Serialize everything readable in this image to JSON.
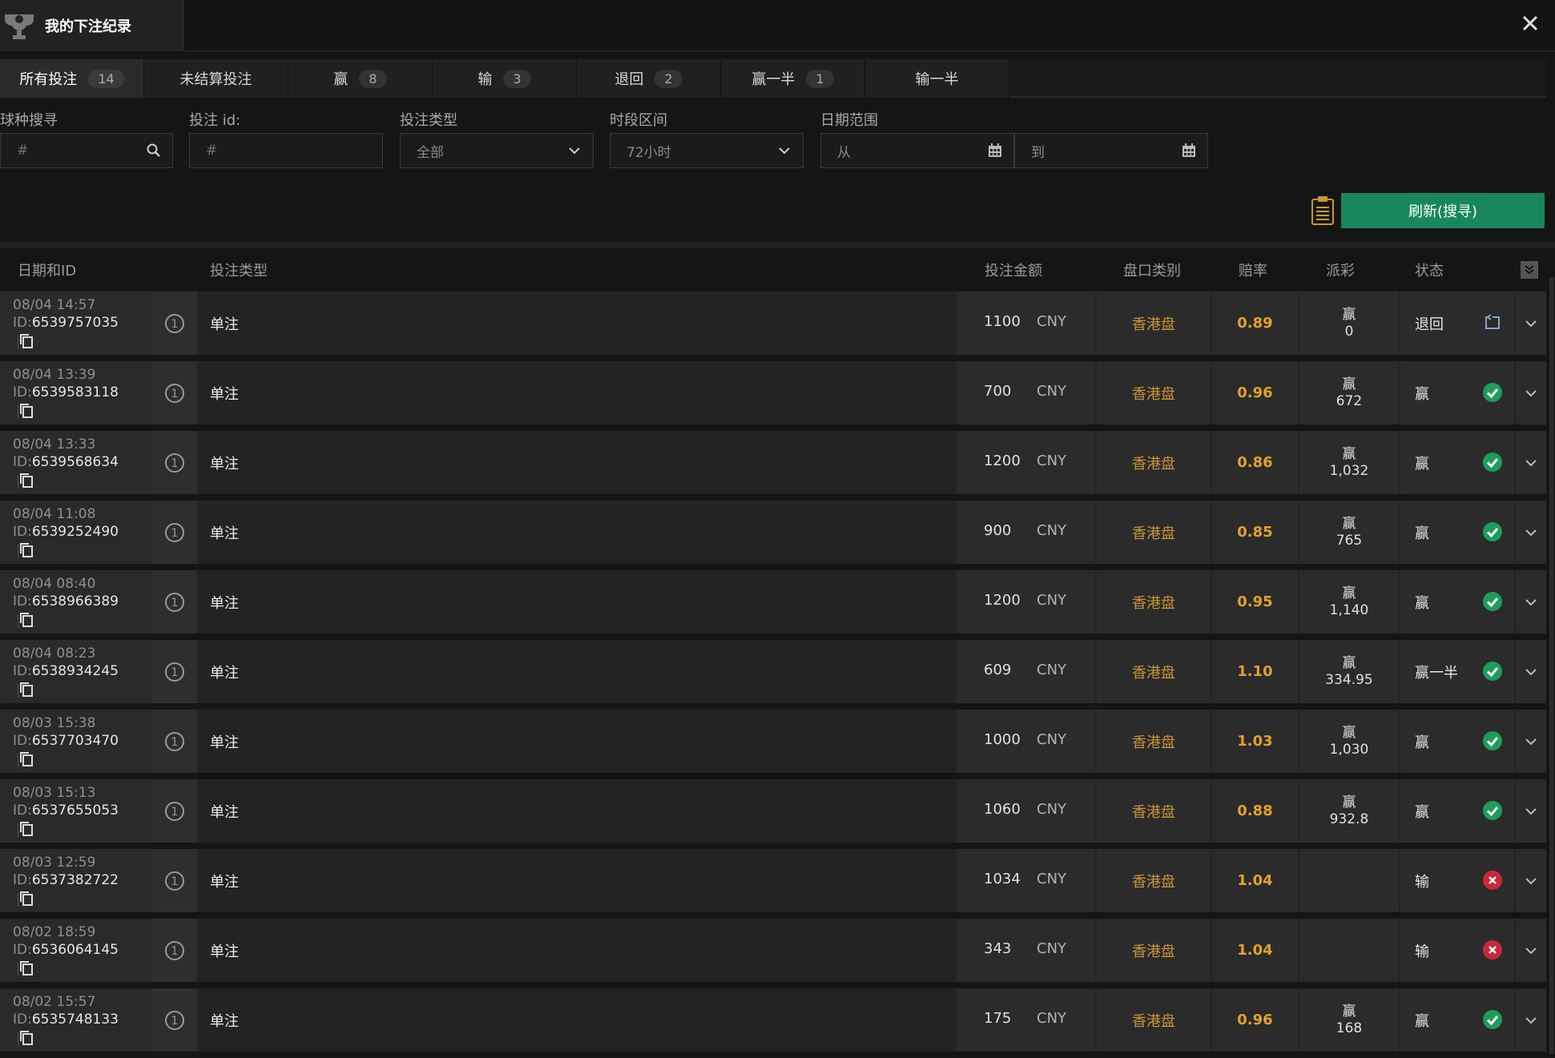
{
  "header": {
    "title": "我的下注纪录"
  },
  "tabs": [
    {
      "label": "所有投注",
      "count": "14"
    },
    {
      "label": "未结算投注",
      "count": ""
    },
    {
      "label": "赢",
      "count": "8"
    },
    {
      "label": "输",
      "count": "3"
    },
    {
      "label": "退回",
      "count": "2"
    },
    {
      "label": "赢一半",
      "count": "1"
    },
    {
      "label": "输一半",
      "count": ""
    }
  ],
  "filters": {
    "sport_label": "球种搜寻",
    "sport_placeholder": "#",
    "betid_label": "投注 id:",
    "betid_placeholder": "#",
    "bettype_label": "投注类型",
    "bettype_value": "全部",
    "period_label": "时段区间",
    "period_value": "72小时",
    "daterange_label": "日期范围",
    "from_placeholder": "从",
    "to_placeholder": "到"
  },
  "refresh_label": "刷新(搜寻)",
  "table_headers": {
    "date_id": "日期和ID",
    "bet_type": "投注类型",
    "amount": "投注金额",
    "market": "盘口类别",
    "odds": "赔率",
    "payout": "派彩",
    "status": "状态"
  },
  "colors": {
    "accent_green": "#18875b",
    "odds_orange": "#e3a12c",
    "market_gold": "#c99436",
    "win_green": "#1e9c5a",
    "lose_red": "#c8283c"
  },
  "rows": [
    {
      "date": "08/04 14:57",
      "id_prefix": "ID:",
      "id": "6539757035",
      "num": "1",
      "type": "单注",
      "amount": "1100",
      "currency": "CNY",
      "market": "香港盘",
      "odds": "0.89",
      "payout_label": "赢",
      "payout_value": "0",
      "status": "退回",
      "status_icon": "refund-icon"
    },
    {
      "date": "08/04 13:39",
      "id_prefix": "ID:",
      "id": "6539583118",
      "num": "1",
      "type": "单注",
      "amount": "700",
      "currency": "CNY",
      "market": "香港盘",
      "odds": "0.96",
      "payout_label": "赢",
      "payout_value": "672",
      "status": "赢",
      "status_icon": "check-icon"
    },
    {
      "date": "08/04 13:33",
      "id_prefix": "ID:",
      "id": "6539568634",
      "num": "1",
      "type": "单注",
      "amount": "1200",
      "currency": "CNY",
      "market": "香港盘",
      "odds": "0.86",
      "payout_label": "赢",
      "payout_value": "1,032",
      "status": "赢",
      "status_icon": "check-icon"
    },
    {
      "date": "08/04 11:08",
      "id_prefix": "ID:",
      "id": "6539252490",
      "num": "1",
      "type": "单注",
      "amount": "900",
      "currency": "CNY",
      "market": "香港盘",
      "odds": "0.85",
      "payout_label": "赢",
      "payout_value": "765",
      "status": "赢",
      "status_icon": "check-icon"
    },
    {
      "date": "08/04 08:40",
      "id_prefix": "ID:",
      "id": "6538966389",
      "num": "1",
      "type": "单注",
      "amount": "1200",
      "currency": "CNY",
      "market": "香港盘",
      "odds": "0.95",
      "payout_label": "赢",
      "payout_value": "1,140",
      "status": "赢",
      "status_icon": "check-icon"
    },
    {
      "date": "08/04 08:23",
      "id_prefix": "ID:",
      "id": "6538934245",
      "num": "1",
      "type": "单注",
      "amount": "609",
      "currency": "CNY",
      "market": "香港盘",
      "odds": "1.10",
      "payout_label": "赢",
      "payout_value": "334.95",
      "status": "赢一半",
      "status_icon": "check-icon"
    },
    {
      "date": "08/03 15:38",
      "id_prefix": "ID:",
      "id": "6537703470",
      "num": "1",
      "type": "单注",
      "amount": "1000",
      "currency": "CNY",
      "market": "香港盘",
      "odds": "1.03",
      "payout_label": "赢",
      "payout_value": "1,030",
      "status": "赢",
      "status_icon": "check-icon"
    },
    {
      "date": "08/03 15:13",
      "id_prefix": "ID:",
      "id": "6537655053",
      "num": "1",
      "type": "单注",
      "amount": "1060",
      "currency": "CNY",
      "market": "香港盘",
      "odds": "0.88",
      "payout_label": "赢",
      "payout_value": "932.8",
      "status": "赢",
      "status_icon": "check-icon"
    },
    {
      "date": "08/03 12:59",
      "id_prefix": "ID:",
      "id": "6537382722",
      "num": "1",
      "type": "单注",
      "amount": "1034",
      "currency": "CNY",
      "market": "香港盘",
      "odds": "1.04",
      "payout_label": "",
      "payout_value": "",
      "status": "输",
      "status_icon": "cross-icon"
    },
    {
      "date": "08/02 18:59",
      "id_prefix": "ID:",
      "id": "6536064145",
      "num": "1",
      "type": "单注",
      "amount": "343",
      "currency": "CNY",
      "market": "香港盘",
      "odds": "1.04",
      "payout_label": "",
      "payout_value": "",
      "status": "输",
      "status_icon": "cross-icon"
    },
    {
      "date": "08/02 15:57",
      "id_prefix": "ID:",
      "id": "6535748133",
      "num": "1",
      "type": "单注",
      "amount": "175",
      "currency": "CNY",
      "market": "香港盘",
      "odds": "0.96",
      "payout_label": "赢",
      "payout_value": "168",
      "status": "赢",
      "status_icon": "check-icon"
    }
  ]
}
